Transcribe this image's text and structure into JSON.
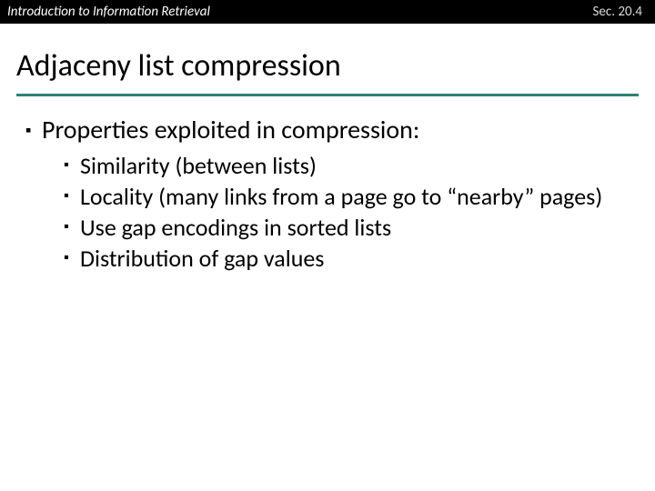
{
  "header": {
    "left": "Introduction to Information Retrieval",
    "right": "Sec. 20.4"
  },
  "title": "Adjaceny list compression",
  "bullets": {
    "main": "Properties exploited in compression:",
    "subs": {
      "s0": "Similarity (between lists)",
      "s1": "Locality (many links from a page go to “nearby” pages)",
      "s2": "Use gap encodings in sorted lists",
      "s3": "Distribution of gap values"
    }
  }
}
